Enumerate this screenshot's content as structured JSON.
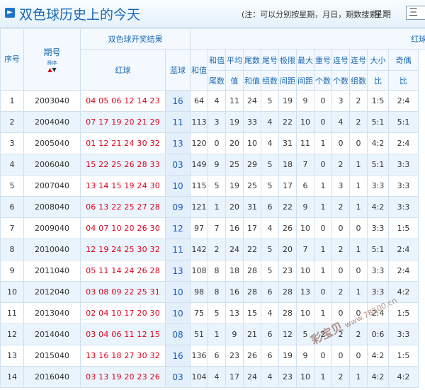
{
  "header": {
    "icon": "arrow-right-icon",
    "title": "双色球历史上的今天",
    "note": "(注：可以分别按星期，月日，期数搜索)",
    "weekday_label": "星期",
    "weekday_value": "三"
  },
  "table": {
    "col_seq": "序号",
    "col_issue": "期号",
    "sort_label": "排序",
    "group_result": "双色球开奖结果",
    "col_red": "红球",
    "col_blue": "蓝球",
    "group_red_analysis": "红球",
    "col_sum": "和值",
    "sub_top": [
      "和值",
      "平均",
      "尾数",
      "尾号",
      "极限",
      "最大",
      "重号",
      "连号",
      "连号",
      "大小",
      "奇偶"
    ],
    "sub_bot": [
      "尾数",
      "值",
      "和值",
      "组数",
      "间距",
      "间距",
      "个数",
      "个数",
      "组数",
      "比",
      "比"
    ],
    "rows": [
      {
        "seq": "1",
        "issue": "2003040",
        "reds": "04 05 06 12 14 23",
        "blue": "16",
        "sum": "64",
        "stats": [
          "4",
          "11",
          "24",
          "5",
          "19",
          "9",
          "0",
          "3",
          "2",
          "1:5",
          "2:4"
        ]
      },
      {
        "seq": "2",
        "issue": "2004040",
        "reds": "07 17 19 20 21 29",
        "blue": "11",
        "sum": "113",
        "stats": [
          "3",
          "19",
          "33",
          "4",
          "22",
          "10",
          "0",
          "4",
          "2",
          "5:1",
          "5:1"
        ]
      },
      {
        "seq": "3",
        "issue": "2005040",
        "reds": "01 12 21 24 30 32",
        "blue": "13",
        "sum": "120",
        "stats": [
          "0",
          "20",
          "10",
          "4",
          "31",
          "11",
          "1",
          "0",
          "0",
          "4:2",
          "2:4"
        ]
      },
      {
        "seq": "4",
        "issue": "2006040",
        "reds": "15 22 25 26 28 33",
        "blue": "03",
        "sum": "149",
        "stats": [
          "9",
          "25",
          "29",
          "5",
          "18",
          "7",
          "0",
          "2",
          "1",
          "5:1",
          "3:3"
        ]
      },
      {
        "seq": "5",
        "issue": "2007040",
        "reds": "13 14 15 19 24 30",
        "blue": "10",
        "sum": "115",
        "stats": [
          "5",
          "19",
          "25",
          "5",
          "17",
          "6",
          "1",
          "3",
          "1",
          "3:3",
          "3:3"
        ]
      },
      {
        "seq": "6",
        "issue": "2008040",
        "reds": "06 13 22 25 27 28",
        "blue": "09",
        "sum": "121",
        "stats": [
          "1",
          "20",
          "31",
          "6",
          "22",
          "9",
          "1",
          "2",
          "1",
          "4:2",
          "3:3"
        ]
      },
      {
        "seq": "7",
        "issue": "2009040",
        "reds": "04 07 10 20 26 30",
        "blue": "12",
        "sum": "97",
        "stats": [
          "7",
          "16",
          "17",
          "4",
          "26",
          "10",
          "0",
          "0",
          "0",
          "3:3",
          "1:5"
        ]
      },
      {
        "seq": "8",
        "issue": "2010040",
        "reds": "12 19 24 25 30 32",
        "blue": "11",
        "sum": "142",
        "stats": [
          "2",
          "24",
          "22",
          "5",
          "20",
          "7",
          "1",
          "2",
          "1",
          "5:1",
          "2:4"
        ]
      },
      {
        "seq": "9",
        "issue": "2011040",
        "reds": "05 11 14 24 26 28",
        "blue": "13",
        "sum": "108",
        "stats": [
          "8",
          "18",
          "28",
          "5",
          "23",
          "10",
          "1",
          "0",
          "0",
          "3:3",
          "2:4"
        ]
      },
      {
        "seq": "10",
        "issue": "2012040",
        "reds": "03 08 09 22 25 31",
        "blue": "10",
        "sum": "98",
        "stats": [
          "8",
          "16",
          "28",
          "6",
          "28",
          "13",
          "0",
          "2",
          "1",
          "3:3",
          "4:2"
        ]
      },
      {
        "seq": "11",
        "issue": "2013040",
        "reds": "02 04 10 17 20 30",
        "blue": "10",
        "sum": "75",
        "stats": [
          "5",
          "13",
          "15",
          "4",
          "28",
          "10",
          "1",
          "0",
          "0",
          "2:4",
          "1:5"
        ]
      },
      {
        "seq": "12",
        "issue": "2014040",
        "reds": "03 04 06 11 12 15",
        "blue": "08",
        "sum": "51",
        "stats": [
          "1",
          "9",
          "21",
          "6",
          "12",
          "5",
          "2",
          "2",
          "2",
          "0:6",
          "3:3"
        ]
      },
      {
        "seq": "13",
        "issue": "2015040",
        "reds": "13 16 18 27 30 32",
        "blue": "16",
        "sum": "136",
        "stats": [
          "6",
          "23",
          "26",
          "6",
          "19",
          "9",
          "0",
          "0",
          "0",
          "4:2",
          "1:5"
        ]
      },
      {
        "seq": "14",
        "issue": "2016040",
        "reds": "03 13 19 20 23 26",
        "blue": "03",
        "sum": "104",
        "stats": [
          "4",
          "17",
          "24",
          "4",
          "23",
          "10",
          "1",
          "2",
          "1",
          "4:2",
          "4:2"
        ]
      }
    ]
  },
  "watermark": {
    "brand": "彩宝贝",
    "site": "www.78500.cn"
  }
}
